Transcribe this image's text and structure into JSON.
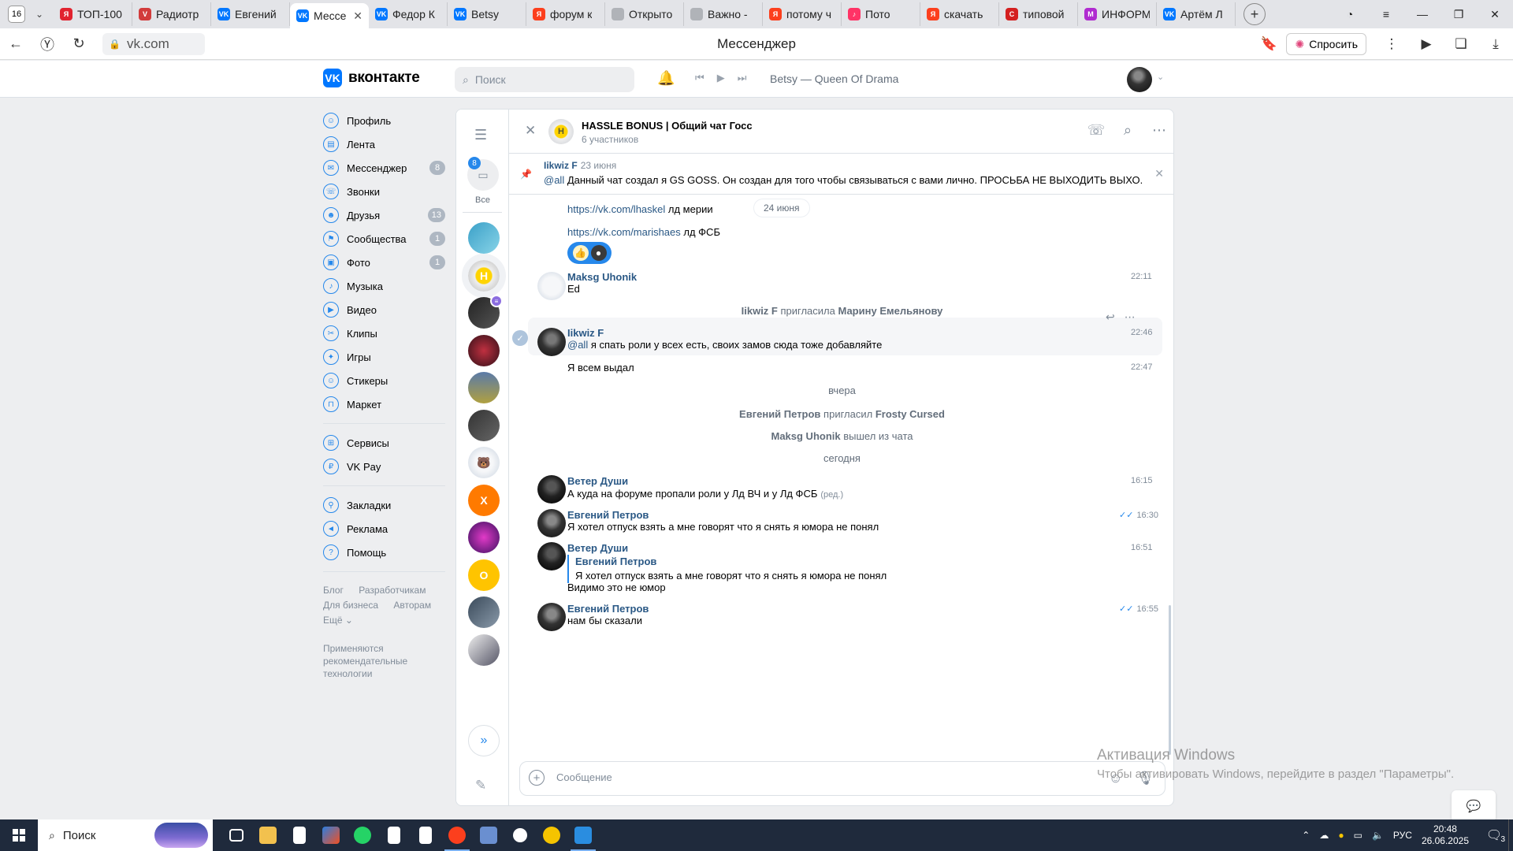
{
  "browser": {
    "tab_count": "16",
    "tabs": [
      {
        "label": "ТОП-100",
        "color": "#e1232f",
        "glyph": "Я"
      },
      {
        "label": "Радиотр",
        "color": "#d23b3b",
        "glyph": "V"
      },
      {
        "label": "Евгений",
        "color": "#0077ff",
        "glyph": "VK"
      },
      {
        "label": "Мессе",
        "color": "#0077ff",
        "glyph": "VK",
        "active": true
      },
      {
        "label": "Федор К",
        "color": "#0077ff",
        "glyph": "VK"
      },
      {
        "label": "Betsy",
        "color": "#0077ff",
        "glyph": "VK"
      },
      {
        "label": "форум к",
        "color": "#fc3f1d",
        "glyph": "Я"
      },
      {
        "label": "Открыто",
        "color": "#b0b3b8",
        "glyph": ""
      },
      {
        "label": "Важно -",
        "color": "#b0b3b8",
        "glyph": ""
      },
      {
        "label": "потому ч",
        "color": "#fc3f1d",
        "glyph": "Я"
      },
      {
        "label": "Пото",
        "color": "#ff3366",
        "glyph": "♪"
      },
      {
        "label": "скачать",
        "color": "#fc3f1d",
        "glyph": "Я"
      },
      {
        "label": "типовой",
        "color": "#d42020",
        "glyph": "C"
      },
      {
        "label": "ИНФОРМ",
        "color": "#b02bd0",
        "glyph": "M"
      },
      {
        "label": "Артём Л",
        "color": "#0077ff",
        "glyph": "VK"
      }
    ],
    "url": "vk.com",
    "page_title": "Мессенджер",
    "ask_label": "Спросить"
  },
  "vk": {
    "logo_text": "вконтакте",
    "search_placeholder": "Поиск",
    "now_playing": "Betsy — Queen Of Drama",
    "nav": [
      {
        "label": "Профиль",
        "icon": "profile-icon",
        "glyph": "☺"
      },
      {
        "label": "Лента",
        "icon": "feed-icon",
        "glyph": "▤"
      },
      {
        "label": "Мессенджер",
        "icon": "messenger-icon",
        "glyph": "✉",
        "count": "8"
      },
      {
        "label": "Звонки",
        "icon": "phone-icon",
        "glyph": "☏"
      },
      {
        "label": "Друзья",
        "icon": "friends-icon",
        "glyph": "☻",
        "count": "13"
      },
      {
        "label": "Сообщества",
        "icon": "communities-icon",
        "glyph": "⚑",
        "count": "1"
      },
      {
        "label": "Фото",
        "icon": "photo-icon",
        "glyph": "▣",
        "count": "1"
      },
      {
        "label": "Музыка",
        "icon": "music-icon",
        "glyph": "♪"
      },
      {
        "label": "Видео",
        "icon": "video-icon",
        "glyph": "▶"
      },
      {
        "label": "Клипы",
        "icon": "clips-icon",
        "glyph": "✂"
      },
      {
        "label": "Игры",
        "icon": "games-icon",
        "glyph": "✦"
      },
      {
        "label": "Стикеры",
        "icon": "stickers-icon",
        "glyph": "☺"
      },
      {
        "label": "Маркет",
        "icon": "market-icon",
        "glyph": "⊓"
      }
    ],
    "nav2": [
      {
        "label": "Сервисы",
        "icon": "services-icon",
        "glyph": "⊞"
      },
      {
        "label": "VK Pay",
        "icon": "vkpay-icon",
        "glyph": "₽"
      }
    ],
    "nav3": [
      {
        "label": "Закладки",
        "icon": "bookmarks-icon",
        "glyph": "⚲"
      },
      {
        "label": "Реклама",
        "icon": "ads-icon",
        "glyph": "◄"
      },
      {
        "label": "Помощь",
        "icon": "help-icon",
        "glyph": "?"
      }
    ],
    "footer_links": [
      "Блог",
      "Разработчикам",
      "Для бизнеса",
      "Авторам",
      "Ещё ⌄"
    ],
    "footer_note": "Применяются рекомендательные технологии"
  },
  "messenger": {
    "folder_all_label": "Все",
    "folder_all_count": "8",
    "chats": [
      {
        "name": "chat-avatar-1",
        "bg": "linear-gradient(135deg,#3aa0c8,#89d4e8)",
        "glyph": ""
      },
      {
        "name": "chat-avatar-2",
        "bg": "radial-gradient(circle,#ffd400 0 35%,#eee 40%,#bbb)",
        "glyph": "H",
        "selected": true
      },
      {
        "name": "chat-avatar-3",
        "bg": "linear-gradient(135deg,#222,#555)",
        "glyph": "",
        "badge": "≡"
      },
      {
        "name": "chat-avatar-4",
        "bg": "radial-gradient(circle,#c03040,#301018)",
        "glyph": ""
      },
      {
        "name": "chat-avatar-5",
        "bg": "linear-gradient(180deg,#5a7aa8,#b0a040)",
        "glyph": ""
      },
      {
        "name": "chat-avatar-6",
        "bg": "linear-gradient(135deg,#333,#666)",
        "glyph": ""
      },
      {
        "name": "chat-avatar-7",
        "bg": "radial-gradient(circle,#f6f7f9 0 40%,#c9d3df)",
        "glyph": "🐻"
      },
      {
        "name": "chat-avatar-8",
        "bg": "#ff7a00",
        "glyph": "X"
      },
      {
        "name": "chat-avatar-9",
        "bg": "radial-gradient(circle,#e23ac8,#3b1060)",
        "glyph": ""
      },
      {
        "name": "chat-avatar-10",
        "bg": "#ffc400",
        "glyph": "O"
      },
      {
        "name": "chat-avatar-11",
        "bg": "linear-gradient(135deg,#3a4a5a,#8a9aaa)",
        "glyph": ""
      },
      {
        "name": "chat-avatar-12",
        "bg": "linear-gradient(135deg,#eee,#556)",
        "glyph": ""
      }
    ],
    "chat_title": "HASSLE BONUS | Общий чат Госс",
    "chat_members": "6 участников",
    "pinned": {
      "author": "Iikwiz F",
      "date": "23 июня",
      "mention": "@all",
      "text": " Данный чат создал я GS GOSS. Он создан для того чтобы связываться с вами лично. ПРОСЬБА НЕ ВЫХОДИТЬ ВЫХО..."
    },
    "history": {
      "link1": "https://vk.com/lhaskel",
      "link1_suffix": " лд мерии",
      "date_pill": "24 июня",
      "link2": "https://vk.com/marishaes",
      "link2_suffix": " лд ФСБ",
      "m1_author": "Maksg Uhonik",
      "m1_text": "Ed",
      "m1_time": "22:11",
      "svc1_a": "Iikwiz F",
      "svc1_mid": " пригласила ",
      "svc1_b": "Марину Емельянову",
      "m2_author": "Iikwiz F",
      "m2_mention": "@all",
      "m2_text": " я спать роли у всех есть, своих замов сюда тоже добавляйте",
      "m2_time": "22:46",
      "m3_text": "Я всем выдал",
      "m3_time": "22:47",
      "day1": "вчера",
      "svc2_a": "Евгений Петров",
      "svc2_mid": " пригласил ",
      "svc2_b": "Frosty Cursed",
      "svc3_a": "Maksg Uhonik",
      "svc3_mid": " вышел из чата",
      "day2": "сегодня",
      "m4_author": "Ветер Души",
      "m4_text": "А куда на форуме пропали роли у Лд ВЧ и у Лд ФСБ",
      "m4_edited": "(ред.)",
      "m4_time": "16:15",
      "m5_author": "Евгений Петров",
      "m5_text": "Я хотел отпуск взять а мне говорят что я снять я юмора не понял",
      "m5_time": "16:30",
      "m6_author": "Ветер Души",
      "m6_quote_author": "Евгений Петров",
      "m6_quote_text": "Я хотел отпуск взять а мне говорят что я снять я юмора не понял",
      "m6_text": "Видимо это не юмор",
      "m6_time": "16:51",
      "m7_author": "Евгений Петров",
      "m7_text": "нам бы сказали",
      "m7_time": "16:55"
    },
    "composer_placeholder": "Сообщение"
  },
  "watermark": {
    "line1": "Активация Windows",
    "line2": "Чтобы активировать Windows, перейдите в раздел \"Параметры\"."
  },
  "taskbar": {
    "search_label": "Поиск",
    "lang": "РУС",
    "time": "20:48",
    "date": "26.06.2025",
    "notifications": "3"
  }
}
